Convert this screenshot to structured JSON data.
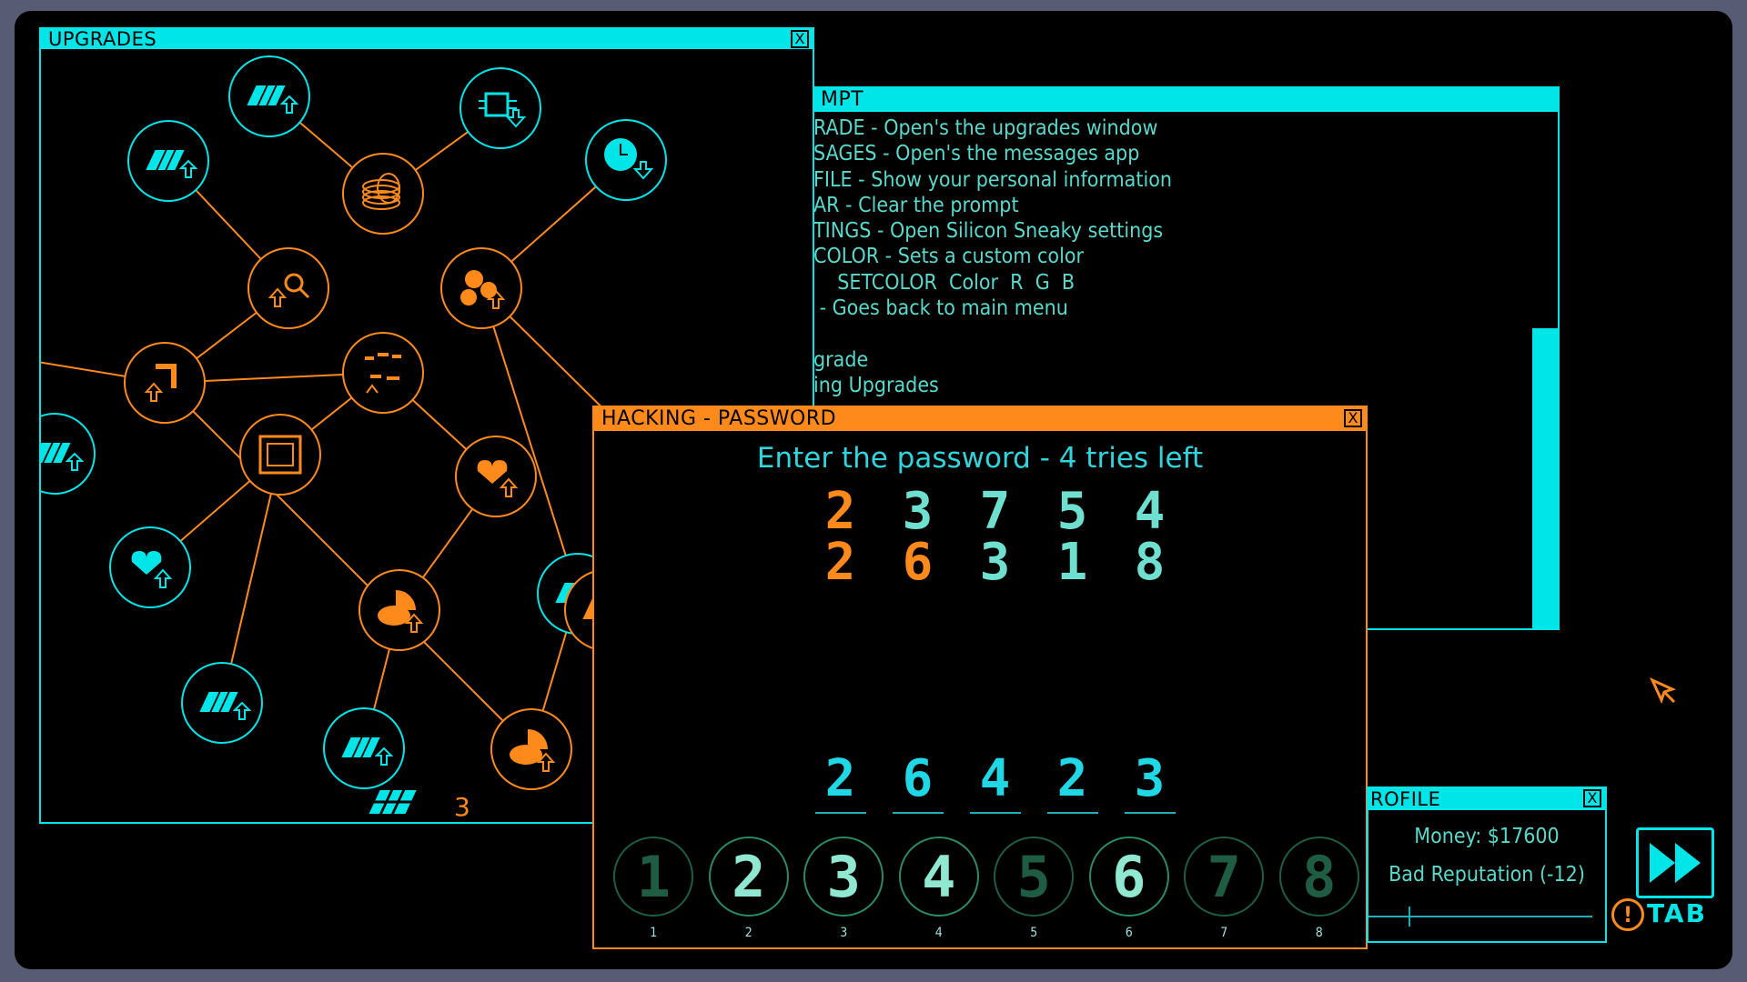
{
  "upgrades": {
    "title": "UPGRADES",
    "close": "X",
    "chip_count": "3",
    "nodes": [
      {
        "color": "cyan",
        "icon": "chip-upgrade-icon"
      },
      {
        "color": "cyan",
        "icon": "chip-upgrade-icon"
      },
      {
        "color": "cyan",
        "icon": "processor-downgrade-icon"
      },
      {
        "color": "cyan",
        "icon": "clock-down-icon"
      },
      {
        "color": "orange",
        "icon": "coins-icon"
      },
      {
        "color": "orange",
        "icon": "search-upgrade-icon"
      },
      {
        "color": "orange",
        "icon": "gears-upgrade-icon"
      },
      {
        "color": "orange",
        "icon": "corner-upgrade-icon"
      },
      {
        "color": "orange",
        "icon": "number-shuffle-icon"
      },
      {
        "color": "orange",
        "icon": "frame-icon"
      },
      {
        "color": "orange",
        "icon": "heart-upgrade-icon"
      },
      {
        "color": "cyan",
        "icon": "heart-upgrade-icon"
      },
      {
        "color": "cyan",
        "icon": "chip-upgrade-icon"
      },
      {
        "color": "orange",
        "icon": "brain-upgrade-icon"
      },
      {
        "color": "cyan",
        "icon": "chip-upgrade-icon"
      },
      {
        "color": "cyan",
        "icon": "chip-upgrade-icon"
      },
      {
        "color": "orange",
        "icon": "brain-upgrade-icon"
      },
      {
        "color": "orange",
        "icon": "chip-upgrade-icon"
      },
      {
        "color": "orange",
        "icon": "node-icon"
      }
    ]
  },
  "prompt": {
    "title": "MPT",
    "lines": [
      "RADE - Open's the upgrades window",
      "SAGES - Open's the messages app",
      "FILE - Show your personal information",
      "AR - Clear the prompt",
      "TINGS - Open Silicon Sneaky settings",
      "COLOR - Sets a custom color",
      "    SETCOLOR  Color  R  G  B",
      " - Goes back to main menu",
      "",
      "grade",
      "ing Upgrades"
    ]
  },
  "password": {
    "title": "HACKING - PASSWORD",
    "close": "X",
    "heading": "Enter the password - 4 tries left",
    "attempts": [
      {
        "digits": [
          "2",
          "3",
          "7",
          "5",
          "4"
        ],
        "colors": [
          "#ff8a1c",
          "#6fe0cf",
          "#6fe0cf",
          "#6fe0cf",
          "#6fe0cf"
        ]
      },
      {
        "digits": [
          "2",
          "6",
          "3",
          "1",
          "8"
        ],
        "colors": [
          "#ff8a1c",
          "#ff8a1c",
          "#6fe0cf",
          "#6fe0cf",
          "#6fe0cf"
        ]
      }
    ],
    "entry": [
      "2",
      "6",
      "4",
      "2",
      "3"
    ],
    "keypad": [
      {
        "value": "1",
        "label": "1",
        "state": "dim"
      },
      {
        "value": "2",
        "label": "2",
        "state": "active"
      },
      {
        "value": "3",
        "label": "3",
        "state": "active"
      },
      {
        "value": "4",
        "label": "4",
        "state": "active"
      },
      {
        "value": "5",
        "label": "5",
        "state": "dim"
      },
      {
        "value": "6",
        "label": "6",
        "state": "active"
      },
      {
        "value": "7",
        "label": "7",
        "state": "dim"
      },
      {
        "value": "8",
        "label": "8",
        "state": "dim"
      }
    ]
  },
  "profile": {
    "title": "ROFILE",
    "close": "X",
    "money": "Money: $17600",
    "reputation": "Bad Reputation (-12)"
  },
  "tab": {
    "label": "TAB",
    "icon": "fast-forward-icon",
    "alert": "!"
  },
  "colors": {
    "cyan": "#00e5e8",
    "orange": "#ff8a1c",
    "teal_text": "#58d9cc",
    "dim_key": "#1e5d44"
  }
}
